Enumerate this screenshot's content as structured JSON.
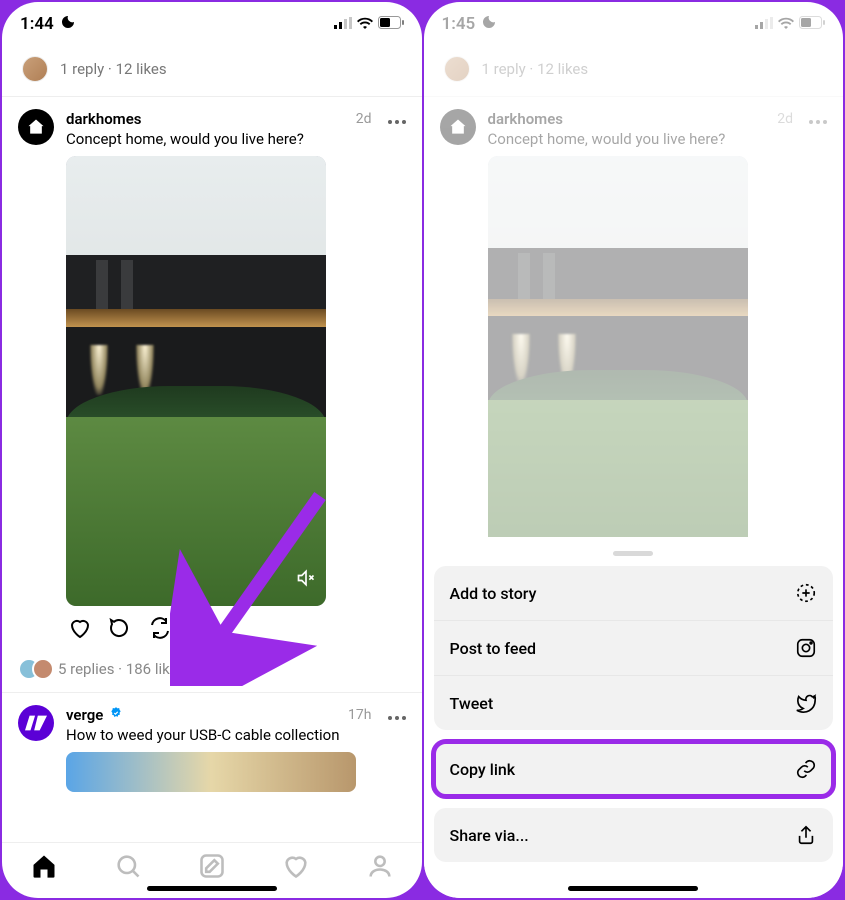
{
  "left": {
    "status": {
      "time": "1:44"
    },
    "reply_summary": "1 reply · 12 likes",
    "post1": {
      "username": "darkhomes",
      "timestamp": "2d",
      "caption": "Concept home, would you live here?"
    },
    "post1_stats": "5 replies · 186 likes",
    "post2": {
      "username": "verge",
      "timestamp": "17h",
      "caption": "How to weed your USB-C cable collection"
    }
  },
  "right": {
    "status": {
      "time": "1:45"
    },
    "reply_summary": "1 reply · 12 likes",
    "post1": {
      "username": "darkhomes",
      "timestamp": "2d",
      "caption": "Concept home, would you live here?"
    },
    "sheet": {
      "group1": [
        {
          "label": "Add to story",
          "icon": "add-story-icon"
        },
        {
          "label": "Post to feed",
          "icon": "instagram-icon"
        },
        {
          "label": "Tweet",
          "icon": "twitter-icon"
        }
      ],
      "group2": [
        {
          "label": "Copy link",
          "icon": "link-icon",
          "highlight": true
        }
      ],
      "group3": [
        {
          "label": "Share via...",
          "icon": "share-icon"
        }
      ]
    }
  }
}
